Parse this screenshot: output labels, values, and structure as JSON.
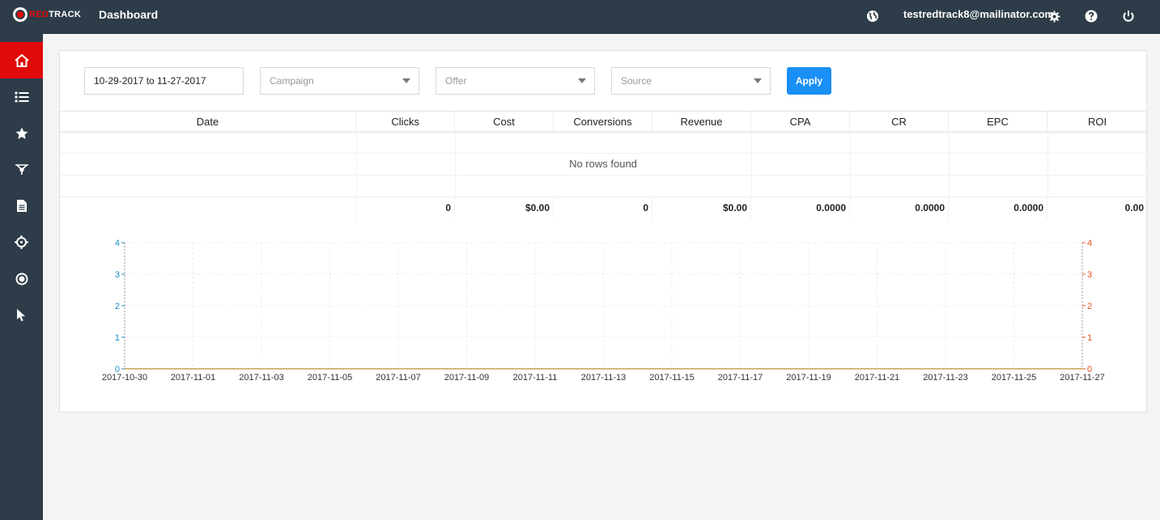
{
  "brand": {
    "logo_part1": "RED",
    "logo_part2": "TRACK"
  },
  "header": {
    "title": "Dashboard",
    "user_email": "testredtrack8@mailinator.com"
  },
  "sidebar": {
    "items": [
      {
        "icon": "home-icon",
        "active": true
      },
      {
        "icon": "list-icon"
      },
      {
        "icon": "star-icon"
      },
      {
        "icon": "funnel-icon"
      },
      {
        "icon": "document-icon"
      },
      {
        "icon": "crosshair-icon"
      },
      {
        "icon": "record-icon"
      },
      {
        "icon": "cursor-icon"
      }
    ]
  },
  "filters": {
    "date_range": "10-29-2017 to 11-27-2017",
    "campaign_placeholder": "Campaign",
    "offer_placeholder": "Offer",
    "source_placeholder": "Source",
    "apply_label": "Apply"
  },
  "table": {
    "columns": [
      "Date",
      "Clicks",
      "Cost",
      "Conversions",
      "Revenue",
      "CPA",
      "CR",
      "EPC",
      "ROI"
    ],
    "empty_message": "No rows found",
    "totals": [
      "",
      "0",
      "$0.00",
      "0",
      "$0.00",
      "0.0000",
      "0.0000",
      "0.0000",
      "0.00"
    ]
  },
  "colors": {
    "accent": "#e10a0a",
    "primary": "#1a8ff5",
    "left_axis": "#1f8cc8",
    "right_axis": "#e8541e"
  },
  "chart_data": {
    "type": "line",
    "x": [
      "2017-10-30",
      "2017-11-01",
      "2017-11-03",
      "2017-11-05",
      "2017-11-07",
      "2017-11-09",
      "2017-11-11",
      "2017-11-13",
      "2017-11-15",
      "2017-11-17",
      "2017-11-19",
      "2017-11-21",
      "2017-11-23",
      "2017-11-25",
      "2017-11-27"
    ],
    "left_yticks": [
      0,
      1,
      2,
      3,
      4
    ],
    "right_yticks": [
      0,
      1,
      2,
      3,
      4
    ],
    "ylim": [
      0,
      4
    ],
    "series": [
      {
        "values": [
          0,
          0,
          0,
          0,
          0,
          0,
          0,
          0,
          0,
          0,
          0,
          0,
          0,
          0,
          0
        ]
      }
    ],
    "grid": true
  }
}
